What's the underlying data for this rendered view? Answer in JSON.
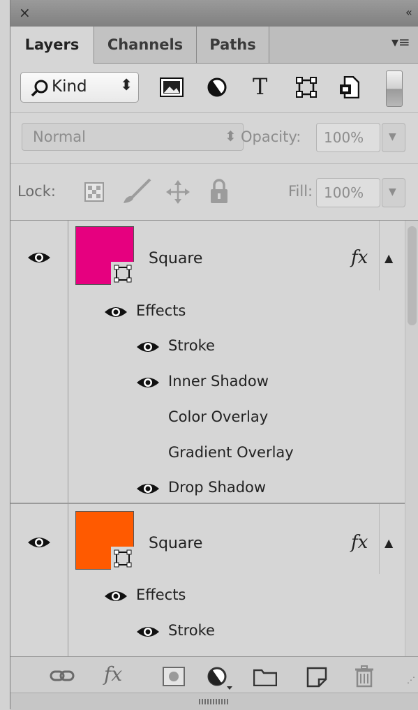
{
  "titlebar": {
    "close_glyph": "×",
    "collapse_glyph": "«"
  },
  "tabs": [
    {
      "label": "Layers",
      "active": true
    },
    {
      "label": "Channels",
      "active": false
    },
    {
      "label": "Paths",
      "active": false
    }
  ],
  "tab_menu_glyph": "▾≡",
  "filter": {
    "kind_label": "Kind",
    "stepper_glyph": "⬍",
    "icons": [
      "image-filter-icon",
      "adjustment-filter-icon",
      "type-filter-icon",
      "shape-filter-icon",
      "smart-object-filter-icon",
      "filter-toggle-icon"
    ],
    "type_glyph": "T"
  },
  "blend": {
    "mode": "Normal",
    "opacity_label": "Opacity:",
    "opacity_value": "100%"
  },
  "lock": {
    "label": "Lock:",
    "fill_label": "Fill:",
    "fill_value": "100%"
  },
  "layers": [
    {
      "name": "Square",
      "color": "#e6007f",
      "fx_label": "fx",
      "effects_label": "Effects",
      "effects": [
        {
          "name": "Stroke",
          "visible": true
        },
        {
          "name": "Inner Shadow",
          "visible": true
        },
        {
          "name": "Color Overlay",
          "visible": false
        },
        {
          "name": "Gradient Overlay",
          "visible": false
        },
        {
          "name": "Drop Shadow",
          "visible": true
        }
      ]
    },
    {
      "name": "Square",
      "color": "#ff5a00",
      "fx_label": "fx",
      "effects_label": "Effects",
      "effects": [
        {
          "name": "Stroke",
          "visible": true
        }
      ]
    }
  ],
  "bottom_icons": [
    "link-icon",
    "fx-icon",
    "mask-icon",
    "adjustment-icon",
    "folder-icon",
    "new-layer-icon",
    "trash-icon"
  ],
  "bottom_fx_label": "fx"
}
